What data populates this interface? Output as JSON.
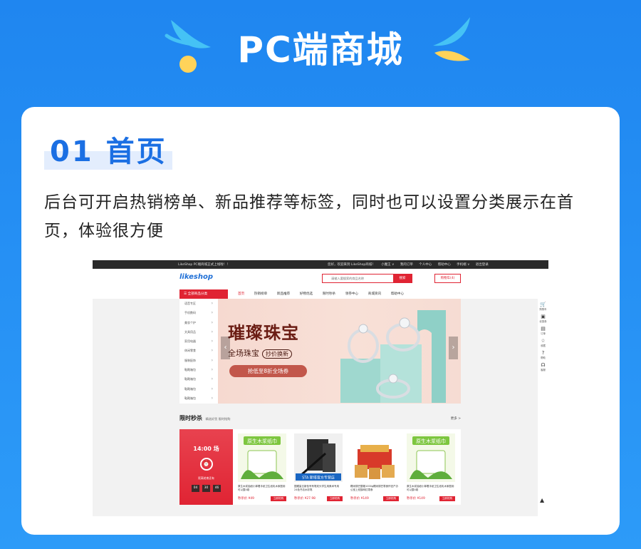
{
  "header": {
    "title": "PC端商城"
  },
  "section": {
    "title": "01 首页",
    "description": "后台可开启热销榜单、新品推荐等标签，同时也可以设置分类展示在首页，体验很方便"
  },
  "shot": {
    "topbar": {
      "notice": "LikeShop PC端商城正式上线啦！！",
      "links": [
        "您好，欢迎来到 LikeShop商城！",
        "小魔王 ∨",
        "我的订单",
        "个人中心",
        "帮助中心",
        "手机端 ∨",
        "退出登录"
      ]
    },
    "logo": "likeshop",
    "search": {
      "placeholder": "请输入要搜索的商品名称",
      "button": "搜索"
    },
    "cart_button": "购物车(4)",
    "all_categories": "全部商品分类",
    "nav": [
      "首页",
      "热销榜单",
      "新品推荐",
      "好物优选",
      "限时秒杀",
      "领券中心",
      "商城资讯",
      "帮助中心"
    ],
    "categories": [
      "语音专区",
      "手机数码",
      "美妆个护",
      "文具用品",
      "家用电器",
      "休闲零食",
      "服装配饰",
      "鞋靴箱包",
      "鞋靴箱包",
      "鞋靴箱包",
      "鞋靴箱包"
    ],
    "banner": {
      "title": "璀璨珠宝",
      "subtitle": "全场珠宝",
      "tag": "抄价换新",
      "pill": "抢低至8折全场券"
    },
    "flash_sale": {
      "title": "限时秒杀",
      "subtitle": "精选好货 限时抢购",
      "more": "更多 >",
      "time": "14:00 场",
      "ends_label": "距离结束还有",
      "countdown": [
        "04",
        "30",
        "46"
      ],
      "buy_label": "立即抢购",
      "products": [
        {
          "name": "原生木浆抽纸小厚着手纸卫生纸乳木家庭用可以整4卷",
          "price": "秒杀价 ¥49",
          "banner": "原生木浆纸巾"
        },
        {
          "name": "国耀量旦新色号有笔双头学生用美术专用 24色书法水彩笔",
          "price": "秒杀价 ¥27.98",
          "banner": "STA 斯塔官方专营店"
        },
        {
          "name": "糯米锅巴整箱1000g糯米锅巴零食怀旧产办公室上班族网红零食",
          "price": "秒杀价 ¥149",
          "banner": ""
        },
        {
          "name": "原生木浆抽纸小厚着手纸卫生纸乳木家庭用可以整4卷",
          "price": "秒杀价 ¥149",
          "banner": "原生木浆纸巾"
        }
      ]
    },
    "sidetools": [
      "购物车",
      "优惠券",
      "订单",
      "收藏",
      "帮助",
      "客服"
    ]
  }
}
